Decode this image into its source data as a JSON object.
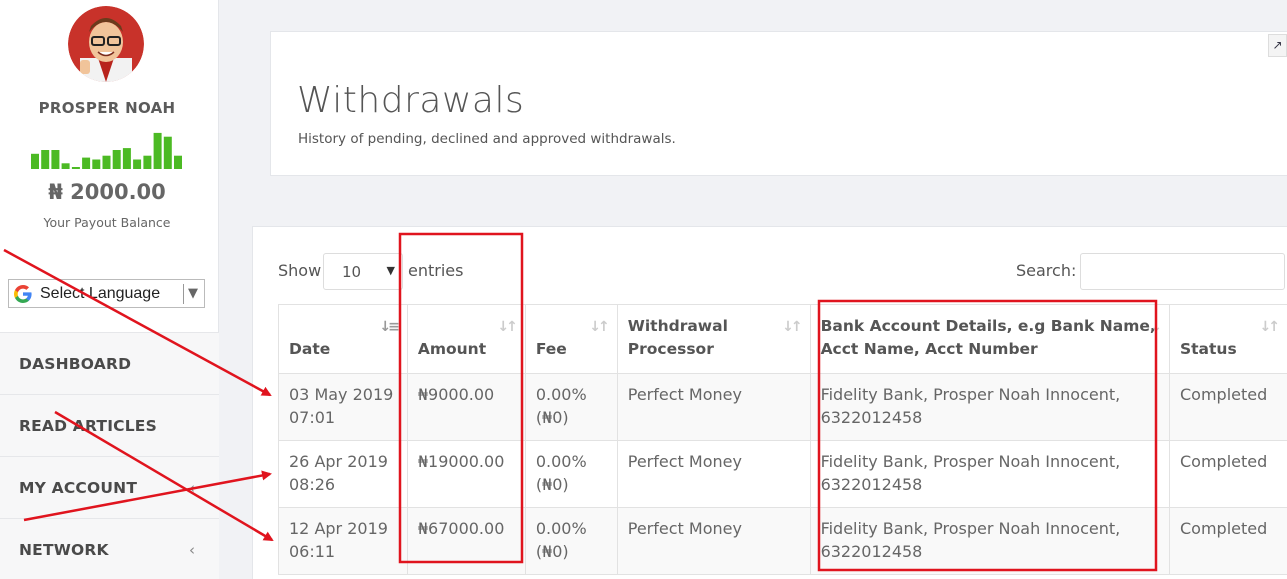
{
  "user": {
    "name": "PROSPER NOAH",
    "balance": "₦ 2000.00",
    "balance_caption": "Your Payout Balance"
  },
  "sparkline": {
    "color": "#4cba24",
    "values": [
      0.4,
      0.5,
      0.5,
      0.15,
      0.05,
      0.3,
      0.25,
      0.35,
      0.5,
      0.55,
      0.25,
      0.35,
      0.95,
      0.85,
      0.35
    ]
  },
  "language": {
    "label": "Select Language"
  },
  "nav": [
    {
      "label": "DASHBOARD",
      "chevron": ""
    },
    {
      "label": "READ ARTICLES",
      "chevron": ""
    },
    {
      "label": "MY ACCOUNT",
      "chevron": "‹"
    },
    {
      "label": "NETWORK",
      "chevron": "‹"
    }
  ],
  "page": {
    "title": "Withdrawals",
    "subtitle": "History of pending, declined and approved withdrawals."
  },
  "table_controls": {
    "show_label": "Show",
    "page_length": "10",
    "entries_label": "entries",
    "search_label": "Search:"
  },
  "table": {
    "headers": [
      {
        "line1": "",
        "line2": "Date"
      },
      {
        "line1": "",
        "line2": "Amount"
      },
      {
        "line1": "",
        "line2": "Fee"
      },
      {
        "line1": "Withdrawal",
        "line2": "Processor"
      },
      {
        "line1": "Bank Account Details, e.g Bank Name,",
        "line2": "Acct Name, Acct Number"
      },
      {
        "line1": "",
        "line2": "Status"
      }
    ],
    "rows": [
      {
        "date1": "03 May 2019",
        "date2": "07:01",
        "amount": "₦9000.00",
        "fee1": "0.00%",
        "fee2": "(₦0)",
        "processor": "Perfect Money",
        "bank1": "Fidelity Bank, Prosper Noah Innocent,",
        "bank2": "6322012458",
        "status": "Completed"
      },
      {
        "date1": "26 Apr 2019",
        "date2": "08:26",
        "amount": "₦19000.00",
        "fee1": "0.00%",
        "fee2": "(₦0)",
        "processor": "Perfect Money",
        "bank1": "Fidelity Bank, Prosper Noah Innocent,",
        "bank2": "6322012458",
        "status": "Completed"
      },
      {
        "date1": "12 Apr 2019",
        "date2": "06:11",
        "amount": "₦67000.00",
        "fee1": "0.00%",
        "fee2": "(₦0)",
        "processor": "Perfect Money",
        "bank1": "Fidelity Bank, Prosper Noah Innocent,",
        "bank2": "6322012458",
        "status": "Completed"
      }
    ]
  },
  "annotation_color": "#e0141e"
}
